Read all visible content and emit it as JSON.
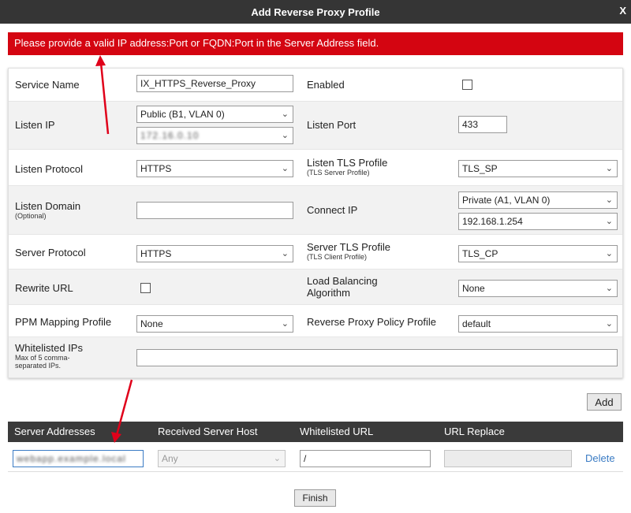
{
  "dialog": {
    "title": "Add Reverse Proxy Profile",
    "close_label": "X"
  },
  "error": {
    "message": "Please provide a valid IP address:Port or FQDN:Port in the Server Address field."
  },
  "form": {
    "service_name": {
      "label": "Service Name",
      "value": "IX_HTTPS_Reverse_Proxy"
    },
    "enabled": {
      "label": "Enabled",
      "checked": false
    },
    "listen_ip": {
      "label": "Listen IP",
      "interface_value": "Public (B1, VLAN 0)",
      "address_value": "172.16.0.10"
    },
    "listen_port": {
      "label": "Listen Port",
      "value": "433"
    },
    "listen_protocol": {
      "label": "Listen Protocol",
      "value": "HTTPS"
    },
    "listen_tls_profile": {
      "label": "Listen TLS Profile",
      "sublabel": "(TLS Server Profile)",
      "value": "TLS_SP"
    },
    "listen_domain": {
      "label": "Listen Domain",
      "sublabel": "(Optional)",
      "value": ""
    },
    "connect_ip": {
      "label": "Connect IP",
      "interface_value": "Private (A1, VLAN 0)",
      "address_value": "192.168.1.254"
    },
    "server_protocol": {
      "label": "Server Protocol",
      "value": "HTTPS"
    },
    "server_tls_profile": {
      "label": "Server TLS Profile",
      "sublabel": "(TLS Client Profile)",
      "value": "TLS_CP"
    },
    "rewrite_url": {
      "label": "Rewrite URL",
      "checked": false
    },
    "load_balancing": {
      "label": "Load Balancing Algorithm",
      "value": "None"
    },
    "ppm_mapping": {
      "label": "PPM Mapping Profile",
      "value": "None"
    },
    "policy_profile": {
      "label": "Reverse Proxy Policy Profile",
      "value": "default"
    },
    "whitelisted_ips": {
      "label": "Whitelisted IPs",
      "sublabel": "Max of 5 comma-separated IPs.",
      "value": ""
    }
  },
  "add_label": "Add",
  "server_table": {
    "headers": [
      "Server Addresses",
      "Received Server Host",
      "Whitelisted URL",
      "URL Replace"
    ],
    "row": {
      "server_address": "webapp.example.local",
      "received_host": "Any",
      "whitelisted_url": "/",
      "url_replace": "",
      "delete_label": "Delete"
    }
  },
  "finish_label": "Finish",
  "colors": {
    "error_red": "#d40511",
    "titlebar": "#353535",
    "annotation_arrow": "#e0001a",
    "link_blue": "#3b7cc4"
  }
}
